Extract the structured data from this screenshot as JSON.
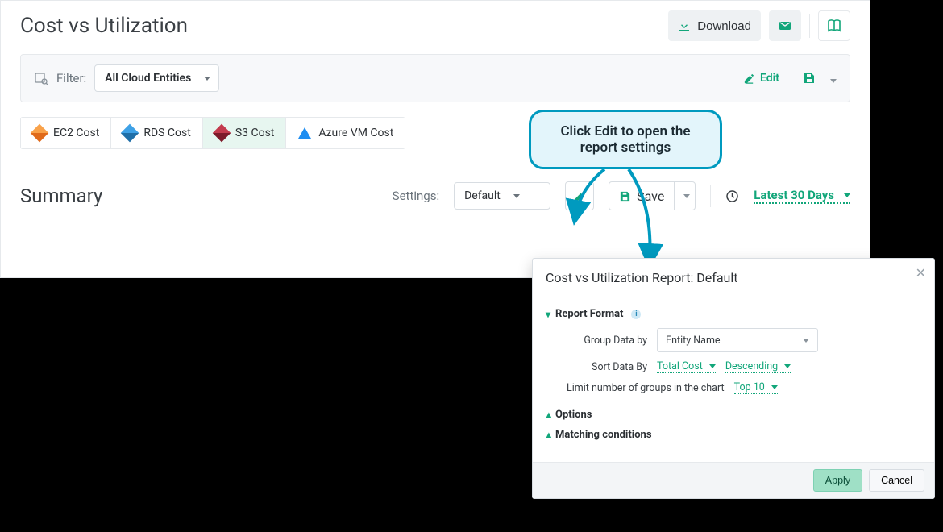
{
  "page": {
    "title": "Cost vs Utilization"
  },
  "header_actions": {
    "download_label": "Download"
  },
  "filter": {
    "label": "Filter:",
    "entity_select": "All Cloud Entities",
    "edit_label": "Edit"
  },
  "tabs": [
    {
      "label": "EC2 Cost",
      "icon": "aws-orange-cube",
      "active": false
    },
    {
      "label": "RDS Cost",
      "icon": "aws-blue-cube",
      "active": false
    },
    {
      "label": "S3 Cost",
      "icon": "aws-red-cube",
      "active": true
    },
    {
      "label": "Azure VM Cost",
      "icon": "azure-triangle",
      "active": false
    }
  ],
  "summary": {
    "title": "Summary",
    "settings_label": "Settings:",
    "settings_value": "Default",
    "save_label": "Save",
    "date_range": "Latest 30 Days"
  },
  "callout": {
    "text": "Click Edit to open the report settings"
  },
  "dialog": {
    "title_prefix": "Cost vs Utilization Report: ",
    "title_name": "Default",
    "sections": {
      "report_format": "Report Format",
      "options": "Options",
      "matching": "Matching conditions"
    },
    "group_by": {
      "label": "Group Data by",
      "value": "Entity Name"
    },
    "sort_by": {
      "label": "Sort Data By",
      "field": "Total Cost",
      "direction": "Descending"
    },
    "limit": {
      "label": "Limit number of groups in the chart",
      "value": "Top 10"
    },
    "buttons": {
      "apply": "Apply",
      "cancel": "Cancel"
    }
  }
}
